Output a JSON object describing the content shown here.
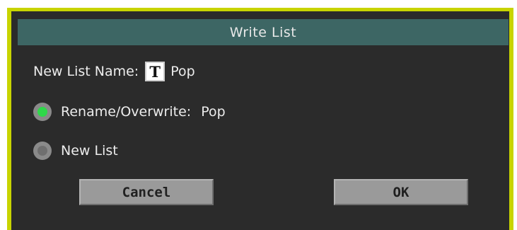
{
  "dialog": {
    "title": "Write List",
    "name_label": "New List Name:",
    "text_icon_glyph": "T",
    "name_value": "Pop",
    "options": [
      {
        "label": "Rename/Overwrite:",
        "value": "Pop",
        "selected": true
      },
      {
        "label": "New List",
        "selected": false
      }
    ],
    "cancel_label": "Cancel",
    "ok_label": "OK"
  },
  "colors": {
    "frame": "#c8d400",
    "panel": "#2b2b2b",
    "titlebar": "#3d6664",
    "radio_active": "#2fd84a",
    "button": "#9a9a9a"
  },
  "icons": {
    "text_edit": "text-edit-icon"
  }
}
